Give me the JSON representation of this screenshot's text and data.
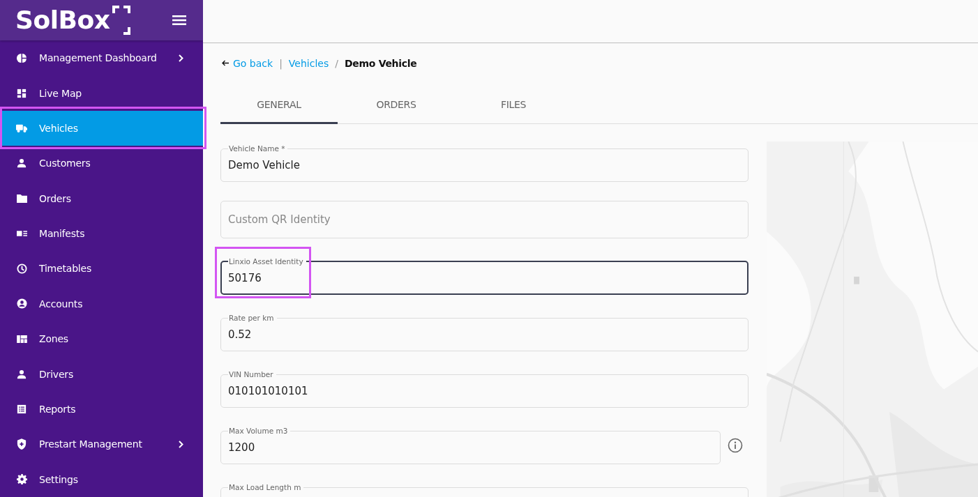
{
  "logo": {
    "text": "SolBox"
  },
  "sidebar": {
    "items": [
      {
        "label": "Management Dashboard",
        "expandable": true,
        "selected": false,
        "highlighted": false
      },
      {
        "label": "Live Map",
        "expandable": false,
        "selected": false,
        "highlighted": false
      },
      {
        "label": "Vehicles",
        "expandable": false,
        "selected": true,
        "highlighted": true
      },
      {
        "label": "Customers",
        "expandable": false,
        "selected": false,
        "highlighted": false
      },
      {
        "label": "Orders",
        "expandable": false,
        "selected": false,
        "highlighted": false
      },
      {
        "label": "Manifests",
        "expandable": false,
        "selected": false,
        "highlighted": false
      },
      {
        "label": "Timetables",
        "expandable": false,
        "selected": false,
        "highlighted": false
      },
      {
        "label": "Accounts",
        "expandable": false,
        "selected": false,
        "highlighted": false
      },
      {
        "label": "Zones",
        "expandable": false,
        "selected": false,
        "highlighted": false
      },
      {
        "label": "Drivers",
        "expandable": false,
        "selected": false,
        "highlighted": false
      },
      {
        "label": "Reports",
        "expandable": false,
        "selected": false,
        "highlighted": false
      },
      {
        "label": "Prestart Management",
        "expandable": true,
        "selected": false,
        "highlighted": false
      },
      {
        "label": "Settings",
        "expandable": false,
        "selected": false,
        "highlighted": false
      }
    ]
  },
  "breadcrumb": {
    "back": "Go back",
    "separator": "|",
    "parent": "Vehicles",
    "slash": "/",
    "current": "Demo Vehicle"
  },
  "tabs": [
    {
      "label": "GENERAL",
      "selected": true
    },
    {
      "label": "ORDERS",
      "selected": false
    },
    {
      "label": "FILES",
      "selected": false
    }
  ],
  "fields": [
    {
      "label": "Vehicle Name *",
      "value": "Demo Vehicle",
      "focused": false,
      "highlighted": false,
      "info": false
    },
    {
      "placeholder": "Custom QR Identity",
      "focused": false,
      "highlighted": false,
      "info": false
    },
    {
      "label": "Linxio Asset Identity",
      "value": "50176",
      "focused": true,
      "highlighted": true,
      "info": false
    },
    {
      "label": "Rate per km",
      "value": "0.52",
      "focused": false,
      "highlighted": false,
      "info": false
    },
    {
      "label": "VIN Number",
      "value": "010101010101",
      "focused": false,
      "highlighted": false,
      "info": false
    },
    {
      "label": "Max Volume m3",
      "value": "1200",
      "focused": false,
      "highlighted": false,
      "info": true
    },
    {
      "label": "Max Load Length m",
      "focused": false,
      "highlighted": false,
      "info": false
    }
  ]
}
